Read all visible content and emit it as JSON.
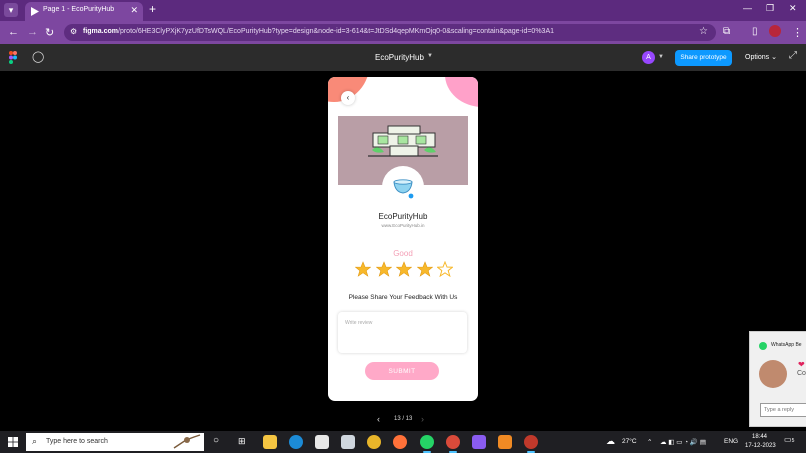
{
  "browser": {
    "tab_title": "Page 1 - EcoPurityHub",
    "url_host": "figma.com",
    "url_rest": "/proto/6HE3ClyPXjK7yzUfDTsWQL/EcoPurityHub?type=design&node-id=3-614&t=JtDSd4qepMKmOjq0-0&scaling=contain&page-id=0%3A1"
  },
  "figma": {
    "project_name": "EcoPurityHub",
    "avatar_initial": "A",
    "share_label": "Share prototype",
    "options_label": "Options"
  },
  "screen": {
    "store_name": "EcoPurityHub",
    "store_website": "www.EcoPurityHub.in",
    "rating_label": "Good",
    "rating_value": 4,
    "rating_max": 5,
    "feedback_prompt": "Please Share Your Feedback With Us",
    "review_placeholder": "Write review",
    "submit_label": "SUBMIT"
  },
  "pager": {
    "text": "13 / 13"
  },
  "whatsapp": {
    "title": "WhatsApp Be",
    "preview": "Co",
    "reply_placeholder": "Type a reply"
  },
  "taskbar": {
    "search_placeholder": "Type here to search",
    "temperature": "27°C",
    "language": "ENG",
    "time": "18:44",
    "date": "17-12-2023",
    "notification_count": "5"
  },
  "colors": {
    "browser_dark": "#5c2a7e",
    "browser_light": "#7d47a0",
    "figma_toolbar": "#2c2c2c",
    "share_blue": "#0d99ff",
    "banner": "#b99ea6",
    "accent_pink": "#ffa9c8",
    "star_filled": "#f7b82b",
    "blob_coral": "#f98a78"
  }
}
